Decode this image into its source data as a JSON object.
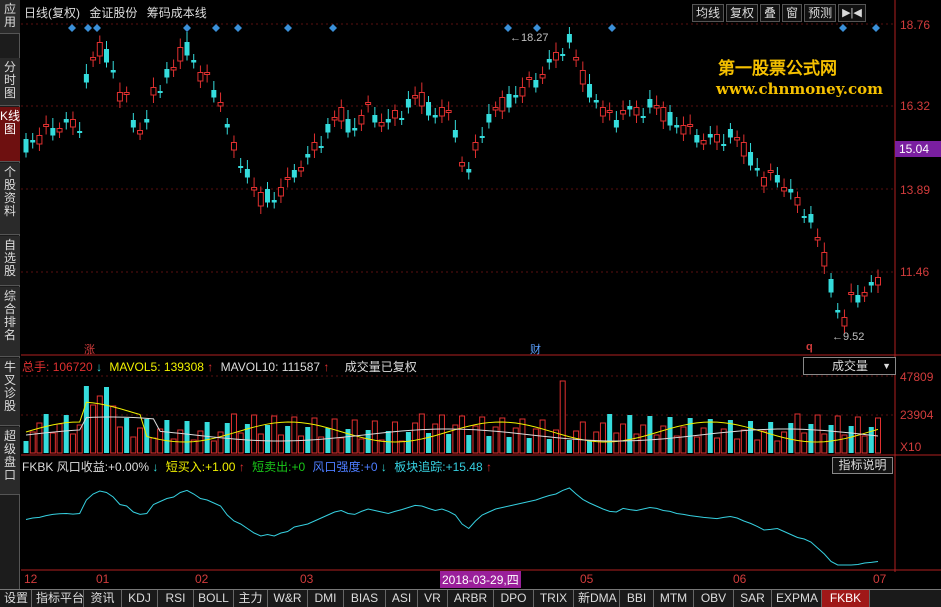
{
  "sidebar": {
    "tabs": [
      {
        "label": "应用",
        "active": false
      },
      {
        "label": "分时图",
        "active": false
      },
      {
        "label": "K线图",
        "active": true
      },
      {
        "label": "个股资料",
        "active": false
      },
      {
        "label": "自选股",
        "active": false
      },
      {
        "label": "综合排名",
        "active": false
      },
      {
        "label": "牛叉诊股",
        "active": false
      },
      {
        "label": "超级盘口",
        "active": false
      }
    ]
  },
  "header": {
    "period": "日线(复权)",
    "stock_name": "金证股份",
    "indicator": "筹码成本线"
  },
  "toolbar": {
    "items": [
      "均线",
      "复权",
      "叠",
      "窗",
      "预测"
    ],
    "nav": "▶|◀"
  },
  "price_axis": {
    "labels": [
      "18.76",
      "16.32",
      "13.89",
      "11.46"
    ],
    "current_price": "15.04"
  },
  "annotations": {
    "high": "18.27",
    "low": "9.52",
    "marker_zhang": "涨",
    "marker_cai": "财",
    "marker_q": "q"
  },
  "watermark": {
    "line1": "第一股票公式网",
    "line2": "www.chnmoney.com"
  },
  "volume": {
    "total_label": "总手:",
    "total_value": "106720",
    "mavol5_label": "MAVOL5:",
    "mavol5_value": "139308",
    "mavol10_label": "MAVOL10:",
    "mavol10_value": "111587",
    "note": "成交量已复权",
    "dropdown": "成交量",
    "axis": [
      "47809",
      "23904",
      "X10"
    ]
  },
  "indicator_panel": {
    "name": "FKBK",
    "items": [
      {
        "label": "风口收益:",
        "value": "+0.00%",
        "color": "#dcdcdc"
      },
      {
        "label": "短买入:",
        "value": "+1.00",
        "color": "#f0f000"
      },
      {
        "label": "短卖出:",
        "value": "+0",
        "color": "#19c819"
      },
      {
        "label": "风口强度:",
        "value": "+0",
        "color": "#4d7dff"
      },
      {
        "label": "板块追踪:",
        "value": "+15.48",
        "color": "#36d0e0"
      }
    ],
    "button": "指标说明"
  },
  "xaxis": {
    "labels": [
      {
        "text": "12"
      },
      {
        "text": "01"
      },
      {
        "text": "02"
      },
      {
        "text": "03"
      },
      {
        "text": "05"
      },
      {
        "text": "06"
      },
      {
        "text": "07"
      }
    ],
    "highlight_date": "2018-03-29,四"
  },
  "bottom_tabs": [
    {
      "label": "设置",
      "active": false
    },
    {
      "label": "指标平台",
      "active": false
    },
    {
      "label": "资讯",
      "active": false
    },
    {
      "label": "KDJ",
      "active": false
    },
    {
      "label": "RSI",
      "active": false
    },
    {
      "label": "BOLL",
      "active": false
    },
    {
      "label": "主力",
      "active": false
    },
    {
      "label": "W&R",
      "active": false
    },
    {
      "label": "DMI",
      "active": false
    },
    {
      "label": "BIAS",
      "active": false
    },
    {
      "label": "ASI",
      "active": false
    },
    {
      "label": "VR",
      "active": false
    },
    {
      "label": "ARBR",
      "active": false
    },
    {
      "label": "DPO",
      "active": false
    },
    {
      "label": "TRIX",
      "active": false
    },
    {
      "label": "新DMA",
      "active": false
    },
    {
      "label": "BBI",
      "active": false
    },
    {
      "label": "MTM",
      "active": false
    },
    {
      "label": "OBV",
      "active": false
    },
    {
      "label": "SAR",
      "active": false
    },
    {
      "label": "EXPMA",
      "active": false
    },
    {
      "label": "FKBK",
      "active": true
    }
  ],
  "colors": {
    "up": "#e03030",
    "down": "#35dcdc",
    "accent": "#7a1fa0"
  }
}
